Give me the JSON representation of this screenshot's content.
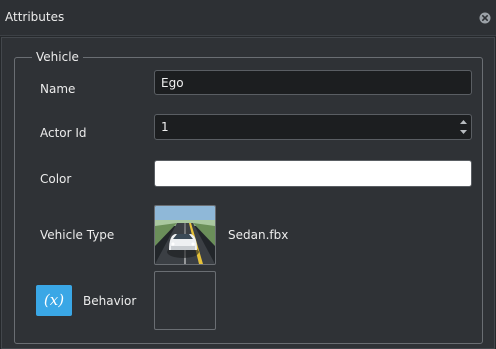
{
  "window": {
    "title": "Attributes",
    "close_icon": "close-circle-icon"
  },
  "vehicle_group": {
    "legend": "Vehicle",
    "name": {
      "label": "Name",
      "value": "Ego"
    },
    "actor_id": {
      "label": "Actor Id",
      "value": "1"
    },
    "color": {
      "label": "Color",
      "value": "#ffffff"
    },
    "vehicle_type": {
      "label": "Vehicle Type",
      "file": "Sedan.fbx"
    },
    "behavior": {
      "label": "Behavior",
      "icon_text": "(x)",
      "icon_color": "#3aa7e6"
    }
  }
}
